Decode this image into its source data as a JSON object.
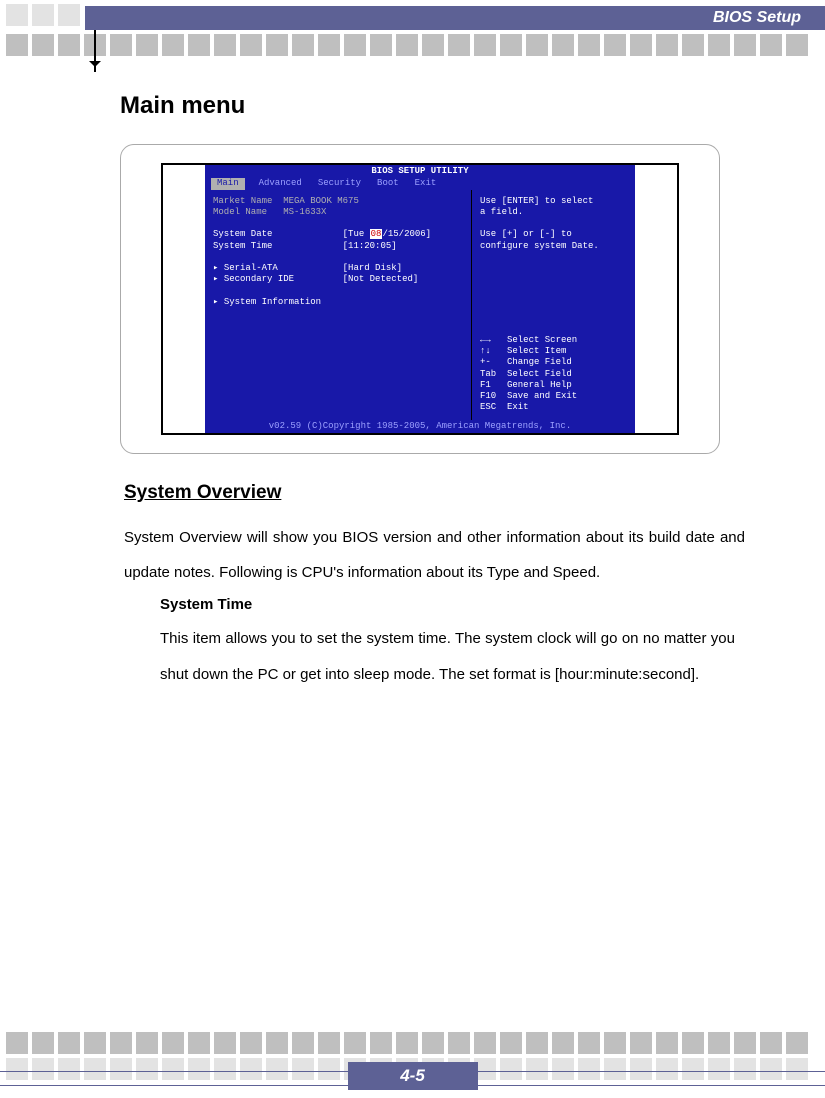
{
  "header": {
    "title": "BIOS Setup"
  },
  "section_title": "Main menu",
  "bios": {
    "title": "BIOS SETUP UTILITY",
    "tabs": [
      "Main",
      "Advanced",
      "Security",
      "Boot",
      "Exit"
    ],
    "market_label": "Market Name",
    "market_value": "MEGA BOOK M675",
    "model_label": "Model Name",
    "model_value": "MS-1633X",
    "date_label": "System Date",
    "date_prefix": "[Tue ",
    "date_sel": "08",
    "date_suffix": "/15/2006]",
    "time_label": "System Time",
    "time_value": "[11:20:05]",
    "sata_label": "Serial-ATA",
    "sata_value": "[Hard Disk]",
    "ide_label": "Secondary IDE",
    "ide_value": "[Not Detected]",
    "sysinfo": "System Information",
    "help1": "Use [ENTER] to select",
    "help2": "a field.",
    "help3": "Use [+] or [-] to",
    "help4": "configure system Date.",
    "nav1": "←→   Select Screen",
    "nav2": "↑↓   Select Item",
    "nav3": "+-   Change Field",
    "nav4": "Tab  Select Field",
    "nav5": "F1   General Help",
    "nav6": "F10  Save and Exit",
    "nav7": "ESC  Exit",
    "footer": "v02.59 (C)Copyright 1985-2005, American Megatrends, Inc."
  },
  "overview_heading": "System Overview",
  "overview_body": "System Overview will show you BIOS version and other information about its build date and update notes. Following is CPU's information about its Type and Speed.",
  "systime_heading": "System Time",
  "systime_body": "This item allows you to set the system time.   The system clock will go on no matter you shut down the PC or get into sleep mode.   The set format is [hour:minute:second].",
  "page_number": "4-5"
}
